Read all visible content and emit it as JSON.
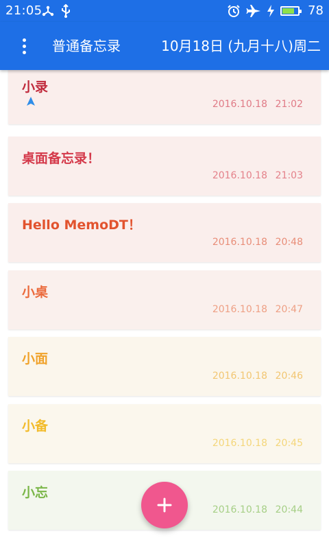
{
  "status_bar": {
    "time": "21:05",
    "icons_left": [
      "share-icon",
      "usb-icon"
    ],
    "icons_right": [
      "alarm-icon",
      "airplane-icon",
      "charging-icon"
    ],
    "battery_level": "78",
    "battery_fraction": 0.78,
    "battery_color": "#8fe04a"
  },
  "app_bar": {
    "background": "#1e6fe6",
    "menu_icon": "more-vert-icon",
    "title": "普通备忘录",
    "date": "10月18日 (九月十八)周二"
  },
  "memos": [
    {
      "title": "小录",
      "date": "2016.10.18",
      "time": "21:02",
      "color": "#c0293b",
      "card_bg": "#faeeec",
      "date_color": "#e07a86",
      "has_location": true
    },
    {
      "title": "桌面备忘录！",
      "date": "2016.10.18",
      "time": "21:03",
      "color": "#d4394a",
      "card_bg": "#faeeec",
      "date_color": "#e4818a",
      "has_location": false
    },
    {
      "title": "Hello MemoDT！",
      "date": "2016.10.18",
      "time": "20:48",
      "color": "#e2532e",
      "card_bg": "#faeeec",
      "date_color": "#e88d78",
      "has_location": false
    },
    {
      "title": "小桌",
      "date": "2016.10.18",
      "time": "20:47",
      "color": "#eb6a3c",
      "card_bg": "#faf0ed",
      "date_color": "#eea085",
      "has_location": false
    },
    {
      "title": "小面",
      "date": "2016.10.18",
      "time": "20:46",
      "color": "#f0a22a",
      "card_bg": "#fbf6ec",
      "date_color": "#f2c672",
      "has_location": false
    },
    {
      "title": "小备",
      "date": "2016.10.18",
      "time": "20:45",
      "color": "#f2bb2a",
      "card_bg": "#fbf7ed",
      "date_color": "#f4d67a",
      "has_location": false
    },
    {
      "title": "小忘",
      "date": "2016.10.18",
      "time": "20:44",
      "color": "#7ab648",
      "card_bg": "#f3f7ee",
      "date_color": "#a6cf86",
      "has_location": false
    }
  ],
  "fab": {
    "icon": "add-icon",
    "color": "#f0578e"
  },
  "location_icon_color": "#2f8de8"
}
